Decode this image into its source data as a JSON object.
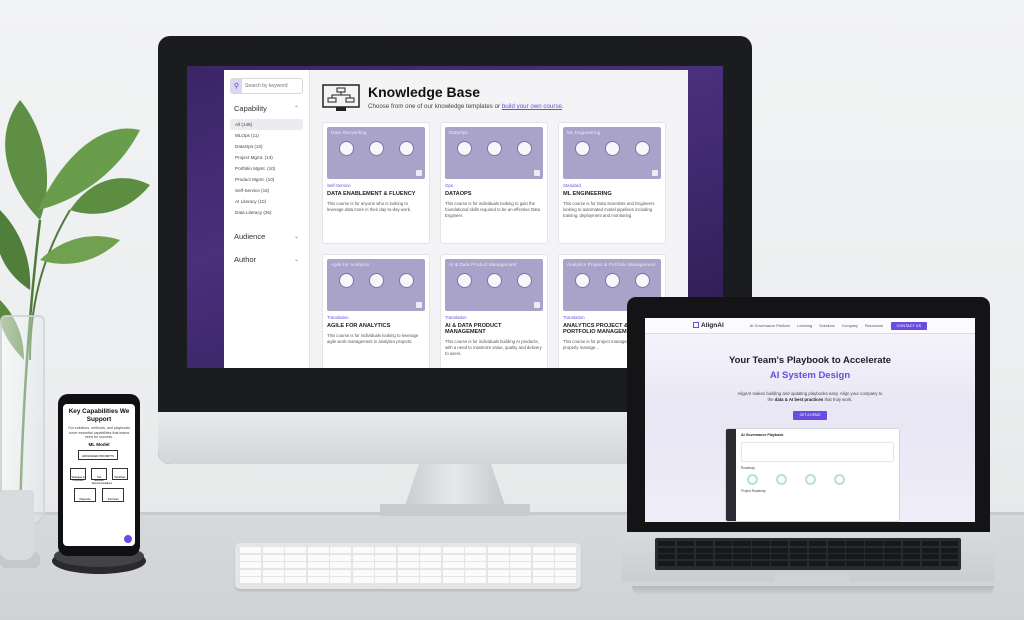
{
  "kb": {
    "search_placeholder": "Search by keyword",
    "title": "Knowledge Base",
    "subtitle": "Choose from one of our knowledge templates or",
    "subtitle_link": "build your own course",
    "subtitle_end": ".",
    "filters": {
      "capability": "Capability",
      "audience": "Audience",
      "author": "Author",
      "items": [
        "All (148)",
        "MLOps (11)",
        "DataOps (10)",
        "Project Mgmt. (13)",
        "Portfolio Mgmt. (10)",
        "Product Mgmt. (10)",
        "Self-Service (15)",
        "AI Literacy (10)",
        "Data Literacy (25)"
      ]
    },
    "cards": [
      {
        "image_caption": "Data Storytelling",
        "tag": "Self-Service",
        "title": "DATA ENABLEMENT & FLUENCY",
        "desc": "This course is for anyone who is looking to leverage data more in their day-to-day work."
      },
      {
        "image_caption": "DataOps",
        "tag": "Ops",
        "title": "DATAOPS",
        "desc": "This course is for individuals looking to gain the foundational skills required to be an effective Data Engineer."
      },
      {
        "image_caption": "ML Engineering",
        "tag": "Standard",
        "title": "ML ENGINEERING",
        "desc": "This course is for Data Scientists and Engineers looking to automated model pipelines including training, deployment and monitoring."
      },
      {
        "image_caption": "Agile for Analytics",
        "tag": "Translation",
        "title": "AGILE FOR ANALYTICS",
        "desc": "This course is for individuals looking to leverage agile work management in analytics projects."
      },
      {
        "image_caption": "AI & Data Product Management",
        "tag": "Translation",
        "title": "AI & DATA PRODUCT MANAGEMENT",
        "desc": "This course is for individuals building AI products, with a need to maximize value, quality and delivery to users."
      },
      {
        "image_caption": "Analytics Project & Portfolio Management",
        "tag": "Translation",
        "title": "ANALYTICS PROJECT & PORTFOLIO MANAGEMENT",
        "desc": "This course is for project managers looking to properly manage..."
      }
    ]
  },
  "phone": {
    "title": "Key Capabilities We Support",
    "text": "Our solutions, methods, and playbooks cover essential capabilities that teams need for success.",
    "ml_label": "ML Model",
    "boxes": [
      "ADVANCED PROMPTS",
      "Strategies & Processes",
      "Tool Selection Recommendations",
      "Workflows",
      "Playbooks",
      "Tool Flows"
    ]
  },
  "laptop": {
    "brand": "AlignAI",
    "nav": [
      "AI Governance Platform",
      "Learning",
      "Solutions",
      "Company",
      "Resources"
    ],
    "contact": "CONTACT US",
    "headline_1": "Your Team's Playbook to Accelerate",
    "headline_2": "AI System Design",
    "para_1": "AlignAI makes building and updating playbooks easy. Align your company to the",
    "para_bold": "data & AI best practices",
    "para_2": "that truly work.",
    "cta": "GET A DEMO",
    "mock_title": "AI Governance Playbook",
    "mock_label_1": "Roadmap",
    "mock_label_2": "Project Roadmap"
  },
  "colors": {
    "accent": "#6a4ce0",
    "card_image": "#a9a2c9",
    "screen_bg": "#3b2565"
  }
}
